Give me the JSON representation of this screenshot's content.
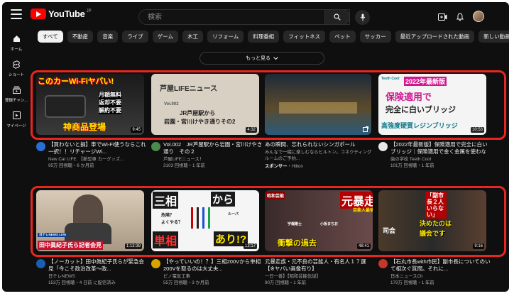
{
  "header": {
    "logo_text": "YouTube",
    "logo_region": "JP",
    "search_placeholder": "検索"
  },
  "sidebar": {
    "items": [
      {
        "label": "ホーム",
        "icon": "home-icon"
      },
      {
        "label": "ショート",
        "icon": "shorts-icon"
      },
      {
        "label": "登録チャン...",
        "icon": "subscriptions-icon"
      },
      {
        "label": "マイページ",
        "icon": "library-icon"
      }
    ]
  },
  "chips": [
    "すべて",
    "不動産",
    "音楽",
    "ライブ",
    "ゲーム",
    "木工",
    "リフォーム",
    "料理番組",
    "フィットネス",
    "ペット",
    "サッカー",
    "最近アップロードされた動画",
    "新しい動画の発見"
  ],
  "show_more": "もっと見る",
  "row1": [
    {
      "thumb_text": [
        "このカーWi-Fiヤバい!",
        "月額無料",
        "返却不要",
        "解約不要",
        "神商品登場"
      ],
      "duration": "9:45",
      "title": "【買わないと損】車でWi-Fi使うならこれ一択！！リチャージWi...",
      "channel": "New Car LIFE　【新型車 カーグッズ...",
      "stats": "95万 回視聴・6 か月前"
    },
    {
      "thumb_text": [
        "芦屋LIFEニュース",
        "Vol.002",
        "JR芦屋駅から",
        "岩園・宮川けやき通りその2"
      ],
      "duration": "4:32",
      "title": "Vol.002　JR芦屋駅から岩園・宮川けやき通り　その２",
      "channel": "芦屋LIFEニュース！",
      "stats": "3103 回視聴・1 年前"
    },
    {
      "thumb_text": [],
      "duration": "",
      "title": "あの瞬間、忘れられないシンガポール",
      "channel": "みんなで一緒に楽しむならヒルトン。コネクティングルームのご予約...",
      "sponsor": "スポンサー",
      "sponsor_name": "・Hilton",
      "stats": ""
    },
    {
      "thumb_text": [
        "2022年最新版",
        "保険適用で",
        "完全に白いブリッジ",
        "高強度硬質レジンブリッジ",
        "Teeth Cool"
      ],
      "duration": "10:53",
      "title": "【2022年最新版】保険適用で完全に白いブリッジ｜保険適用で金く金属を使わない白...",
      "channel": "歯の学校 Teeth Cool",
      "stats": "101万 回視聴・1 年前"
    }
  ],
  "row2": [
    {
      "thumb_text": [
        "田中眞紀子氏ら記者会見",
        "日テレNEWS LIVE"
      ],
      "duration": "1:13:39",
      "title": "【ノーカット】田中眞紀子氏らが緊急会見「今こそ政治改革〜政...",
      "channel": "日テレNEWS",
      "stats": "153万 回視聴・4 日前 に配信済み"
    },
    {
      "thumb_text": [
        "三相",
        "から",
        "単相",
        "あり!?",
        "危険？",
        "よくやる？",
        "ルーパ"
      ],
      "duration": "12:17",
      "title": "【やっていいの！？】三相200Vから単相200Vを取るのは大丈夫...",
      "channel": "ピノ電気工事",
      "stats": "55万 回視聴・3 か月前"
    },
    {
      "thumb_text": [
        "元暴走族",
        "芸能人最強伝説",
        "昭和芸能",
        "宇梶剛士",
        "小坂まちお",
        "衝撃の過去"
      ],
      "duration": "48:41",
      "title": "元暴走族・元不良の芸能人・有名人１７選【※ヤバい画像有り】",
      "channel": "一日一善】【昭和芸能伝説】",
      "stats": "90万 回視聴・1 年前"
    },
    {
      "thumb_text": [
        "「副市長２人いらない」",
        "決めたのは",
        "議会です",
        "司会"
      ],
      "duration": "9:16",
      "title": "【石丸市長with市民】副市長についてのいて相次ぐ質問。それに...",
      "channel": "日本ニュースCh",
      "stats": "179万 回視聴・1 年前"
    }
  ],
  "colors": {
    "background": "#0f0f0f",
    "highlight_box": "#e8261f",
    "chip": "#272727",
    "chip_active": "#f1f1f1",
    "logo_red": "#ff0000"
  }
}
